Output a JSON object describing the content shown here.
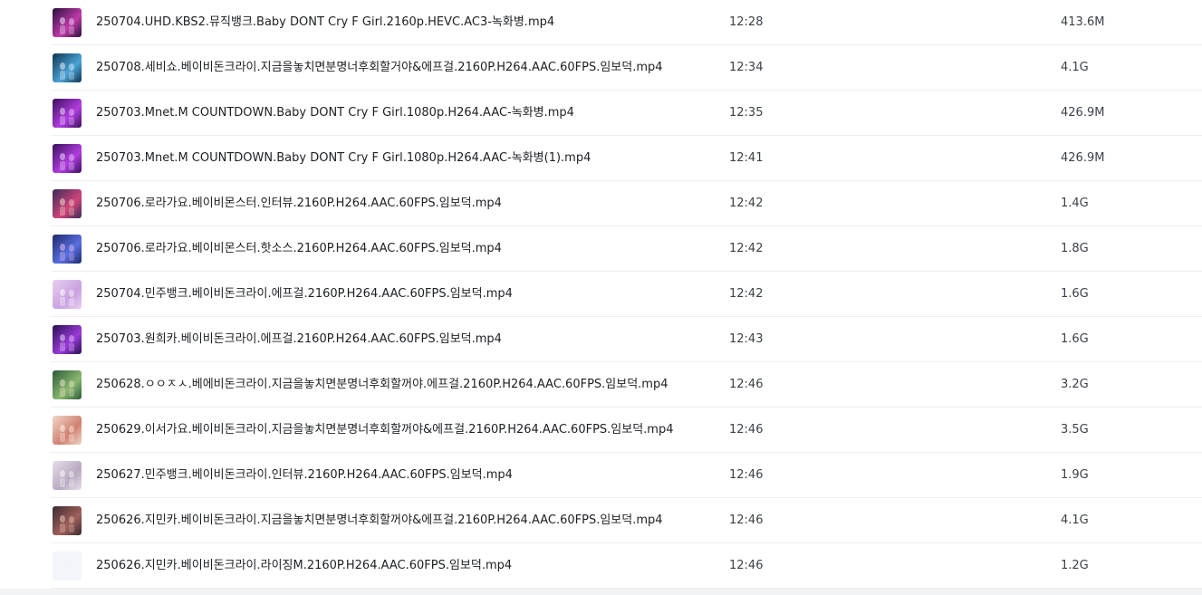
{
  "files": [
    {
      "name": "250704.UHD.KBS2.뮤직뱅크.Baby DONT Cry F Girl.2160p.HEVC.AC3-녹화병.mp4",
      "time": "12:28",
      "size": "413.6M",
      "thumb_icon": "video-thumbnail-icon",
      "thumb_colors": [
        "#2a0f3d",
        "#c03aa8",
        "#f2e6ff"
      ]
    },
    {
      "name": "250708.세비쇼.베이비돈크라이.지금을놓치면분명너후회할거야&에프걸.2160P.H264.AAC.60FPS.임보덕.mp4",
      "time": "12:34",
      "size": "4.1G",
      "thumb_icon": "video-thumbnail-icon",
      "thumb_colors": [
        "#0f3550",
        "#4aa3d6",
        "#e8f4fb"
      ]
    },
    {
      "name": "250703.Mnet.M COUNTDOWN.Baby DONT Cry F Girl.1080p.H264.AAC-녹화병.mp4",
      "time": "12:35",
      "size": "426.9M",
      "thumb_icon": "video-thumbnail-icon",
      "thumb_colors": [
        "#3a0f5c",
        "#b23de0",
        "#f0d8ff"
      ]
    },
    {
      "name": "250703.Mnet.M COUNTDOWN.Baby DONT Cry F Girl.1080p.H264.AAC-녹화병(1).mp4",
      "time": "12:41",
      "size": "426.9M",
      "thumb_icon": "video-thumbnail-icon",
      "thumb_colors": [
        "#3a0f5c",
        "#b23de0",
        "#f0d8ff"
      ]
    },
    {
      "name": "250706.로라가요.베이비몬스터.인터뷰.2160P.H264.AAC.60FPS.임보덕.mp4",
      "time": "12:42",
      "size": "1.4G",
      "thumb_icon": "video-thumbnail-icon",
      "thumb_colors": [
        "#3a2a5a",
        "#d0447a",
        "#f5e0c8"
      ]
    },
    {
      "name": "250706.로라가요.베이비몬스터.핫소스.2160P.H264.AAC.60FPS.임보덕.mp4",
      "time": "12:42",
      "size": "1.8G",
      "thumb_icon": "video-thumbnail-icon",
      "thumb_colors": [
        "#1e2a6a",
        "#5a6ee0",
        "#e0c0f0"
      ]
    },
    {
      "name": "250704.민주뱅크.베이비돈크라이.에프걸.2160P.H264.AAC.60FPS.임보덕.mp4",
      "time": "12:42",
      "size": "1.6G",
      "thumb_icon": "video-thumbnail-icon",
      "thumb_colors": [
        "#e8d0f0",
        "#c9a0e0",
        "#ffffff"
      ]
    },
    {
      "name": "250703.원희카.베이비돈크라이.에프걸.2160P.H264.AAC.60FPS.임보덕.mp4",
      "time": "12:43",
      "size": "1.6G",
      "thumb_icon": "video-thumbnail-icon",
      "thumb_colors": [
        "#2a1050",
        "#9a3ad8",
        "#f0d0ff"
      ]
    },
    {
      "name": "250628.ㅇㅇㅈㅅ.베에비돈크라이.지금을놓치면분명너후회할꺼야.에프걸.2160P.H264.AAC.60FPS.임보덕.mp4",
      "time": "12:46",
      "size": "3.2G",
      "thumb_icon": "video-thumbnail-icon",
      "thumb_colors": [
        "#2a5a3a",
        "#8ab870",
        "#f0e8c8"
      ]
    },
    {
      "name": "250629.이서가요.베이비돈크라이.지금을놓치면분명너후회할꺼야&에프걸.2160P.H264.AAC.60FPS.임보덕.mp4",
      "time": "12:46",
      "size": "3.5G",
      "thumb_icon": "video-thumbnail-icon",
      "thumb_colors": [
        "#f0d8c8",
        "#d08070",
        "#fff4ec"
      ]
    },
    {
      "name": "250627.민주뱅크.베이비돈크라이.인터뷰.2160P.H264.AAC.60FPS.임보덕.mp4",
      "time": "12:46",
      "size": "1.9G",
      "thumb_icon": "video-thumbnail-icon",
      "thumb_colors": [
        "#e6e0ea",
        "#b8a8c0",
        "#fafafa"
      ]
    },
    {
      "name": "250626.지민카.베이비돈크라이.지금을놓치면분명너후회할꺼야&에프걸.2160P.H264.AAC.60FPS.임보덕.mp4",
      "time": "12:46",
      "size": "4.1G",
      "thumb_icon": "video-thumbnail-icon",
      "thumb_colors": [
        "#3a2a30",
        "#a0605a",
        "#e8c8b8"
      ]
    },
    {
      "name": "250626.지민카.베이비돈크라이.라이징M.2160P.H264.AAC.60FPS.임보덕.mp4",
      "time": "12:46",
      "size": "1.2G",
      "thumb_icon": "video-thumbnail-placeholder-icon",
      "thumb_colors": [
        "#f3f5fa",
        "#f3f5fa",
        "#f3f5fa"
      ]
    }
  ]
}
